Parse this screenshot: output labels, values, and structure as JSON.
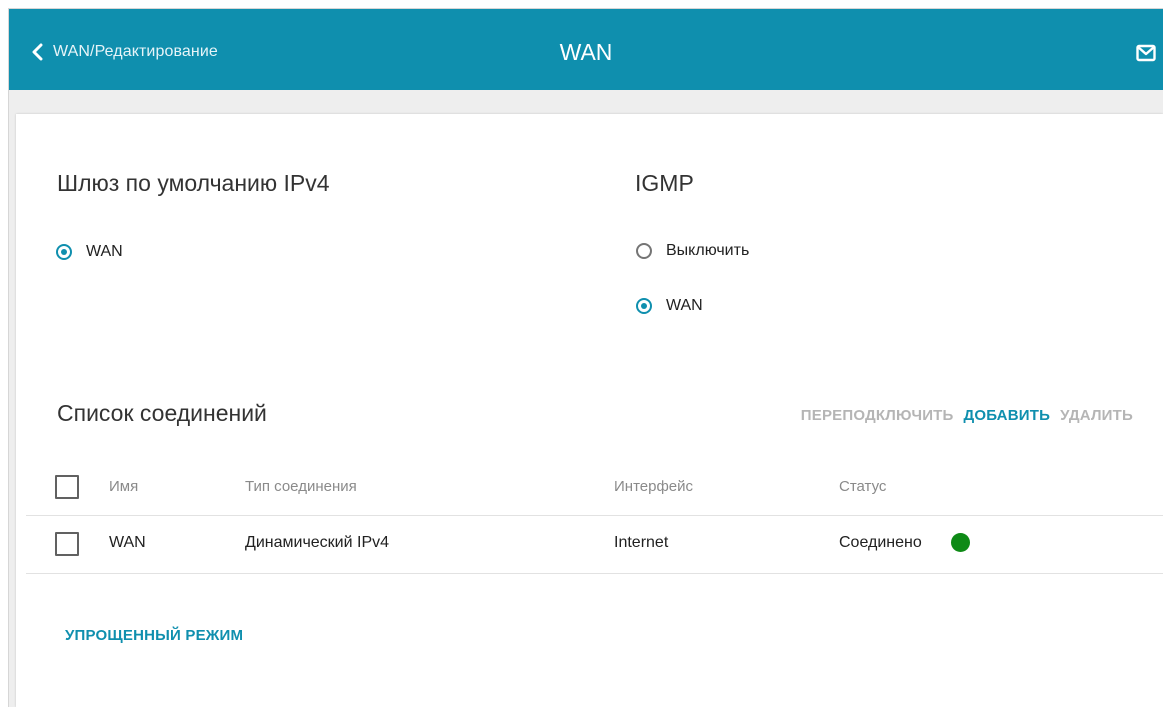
{
  "header": {
    "back_label": "WAN/Редактирование",
    "title": "WAN",
    "accent_color": "#0f8fae",
    "back_icon": "chevron-left-icon",
    "mail_icon": "mail-icon"
  },
  "gateway": {
    "title": "Шлюз по умолчанию IPv4",
    "options": [
      {
        "label": "WAN",
        "selected": true
      }
    ]
  },
  "igmp": {
    "title": "IGMP",
    "options": [
      {
        "label": "Выключить",
        "selected": false
      },
      {
        "label": "WAN",
        "selected": true
      }
    ]
  },
  "connections": {
    "title": "Список соединений",
    "actions": {
      "reconnect": "ПЕРЕПОДКЛЮЧИТЬ",
      "add": "ДОБАВИТЬ",
      "delete": "УДАЛИТЬ"
    },
    "columns": {
      "name": "Имя",
      "type": "Тип соединения",
      "interface": "Интерфейс",
      "status": "Статус"
    },
    "rows": [
      {
        "name": "WAN",
        "type": "Динамический IPv4",
        "interface": "Internet",
        "status": "Соединено",
        "status_color": "#0e8a16",
        "checked": false
      }
    ]
  },
  "footer": {
    "simple_mode": "УПРОЩЕННЫЙ РЕЖИМ"
  }
}
